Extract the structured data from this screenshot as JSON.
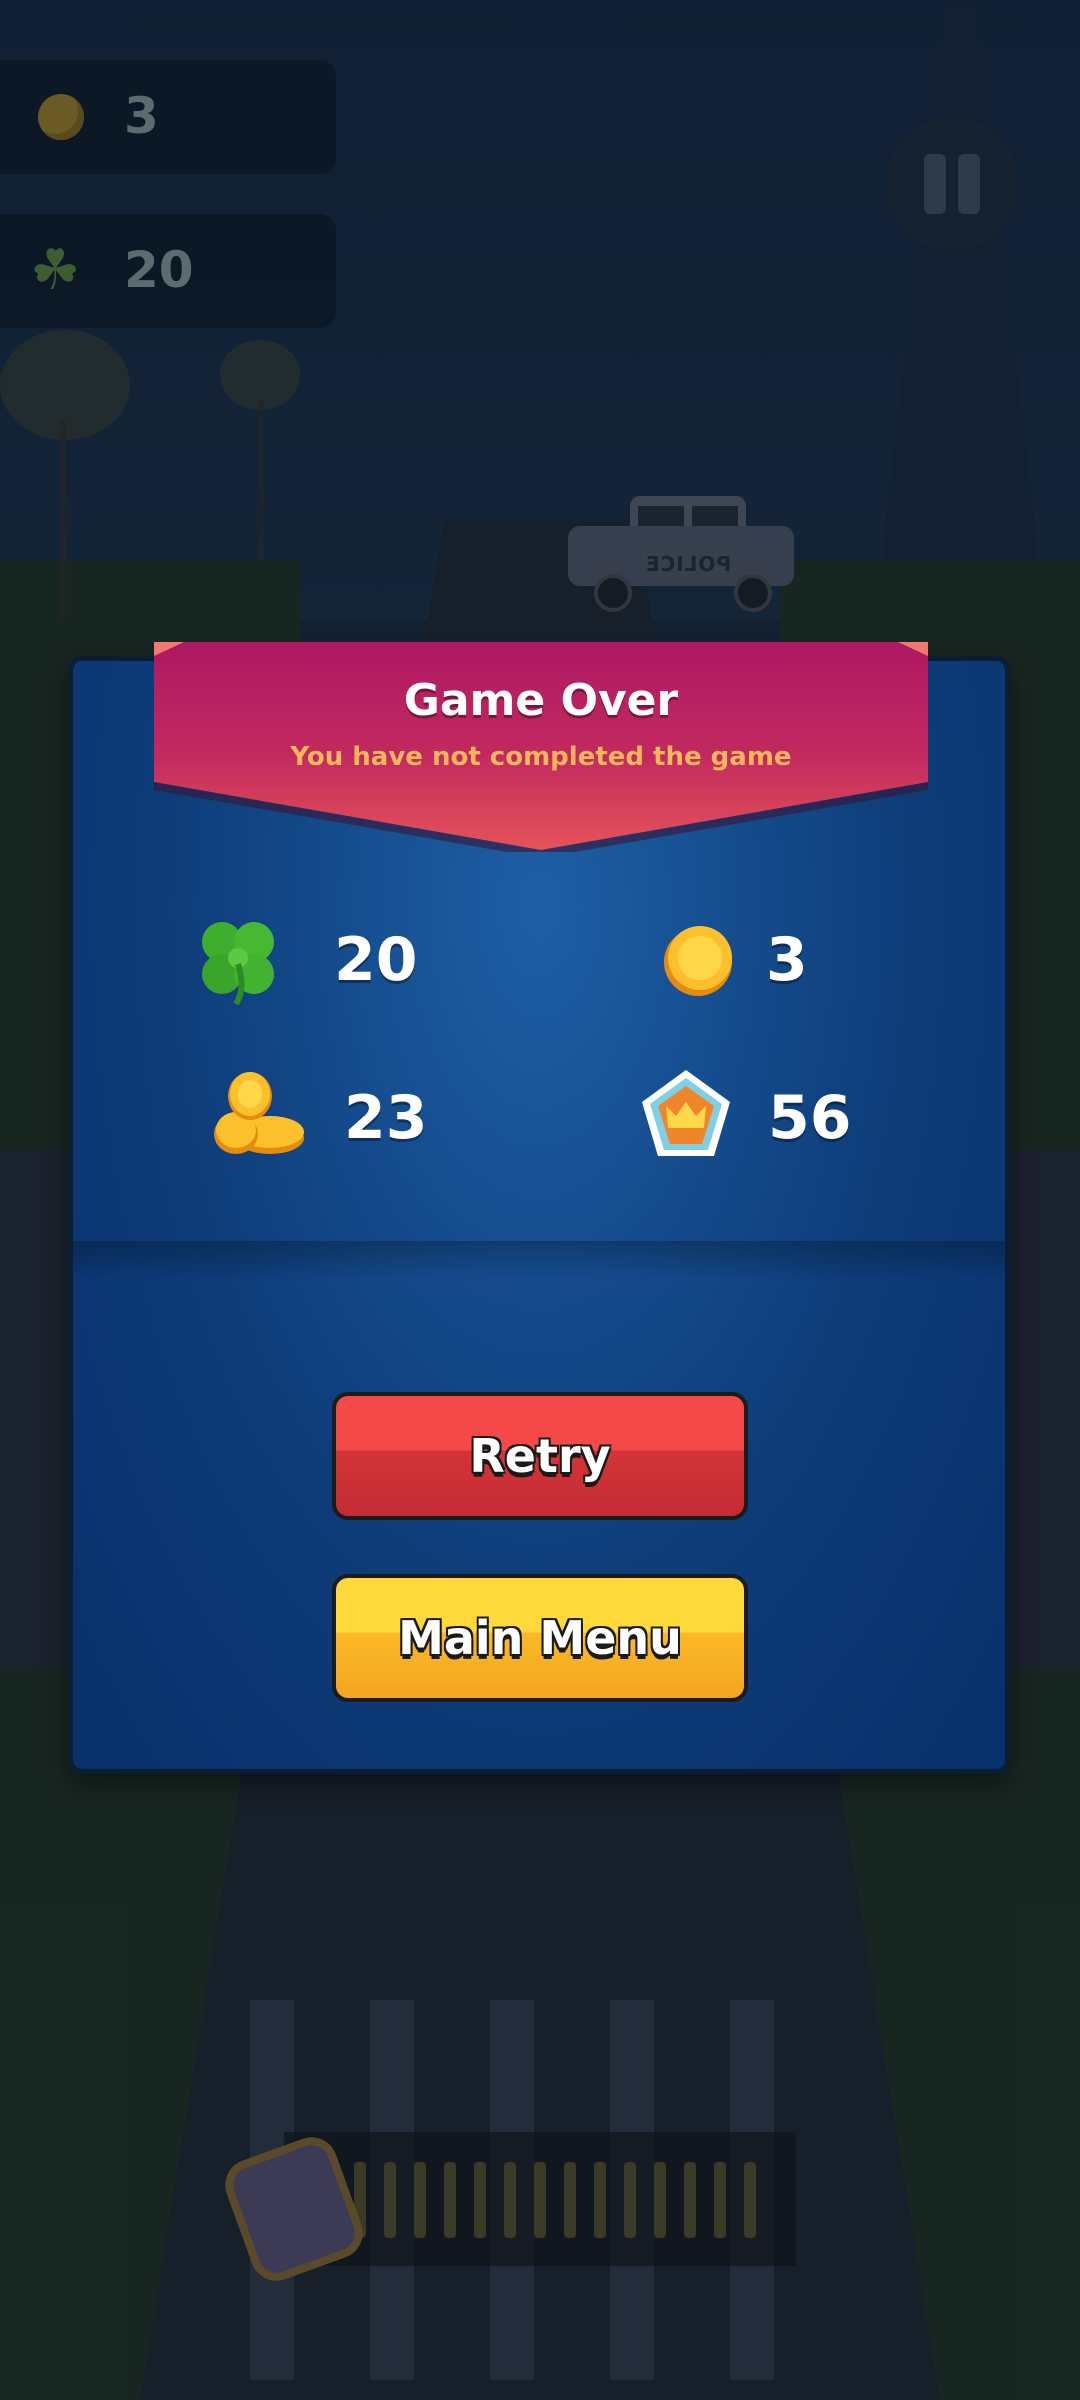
{
  "hud": {
    "coins_value": "3",
    "clovers_value": "20"
  },
  "dialog": {
    "title": "Game Over",
    "subtitle": "You have not completed the game",
    "stats": {
      "clovers": "20",
      "coins": "3",
      "coin_stack": "23",
      "crown_score": "56"
    },
    "retry_label": "Retry",
    "main_menu_label": "Main Menu"
  },
  "scene": {
    "police_text": "POLICE"
  },
  "colors": {
    "modal_blue": "#0e3d7a",
    "banner_pink": "#c52a5d",
    "subtitle_orange": "#f6b85a",
    "retry_red": "#f54848",
    "menu_yellow": "#ffd93a"
  },
  "icons": [
    "coin-icon",
    "clover-icon",
    "pause-icon",
    "coin-stack-icon",
    "crown-badge-icon",
    "jar-icon"
  ]
}
